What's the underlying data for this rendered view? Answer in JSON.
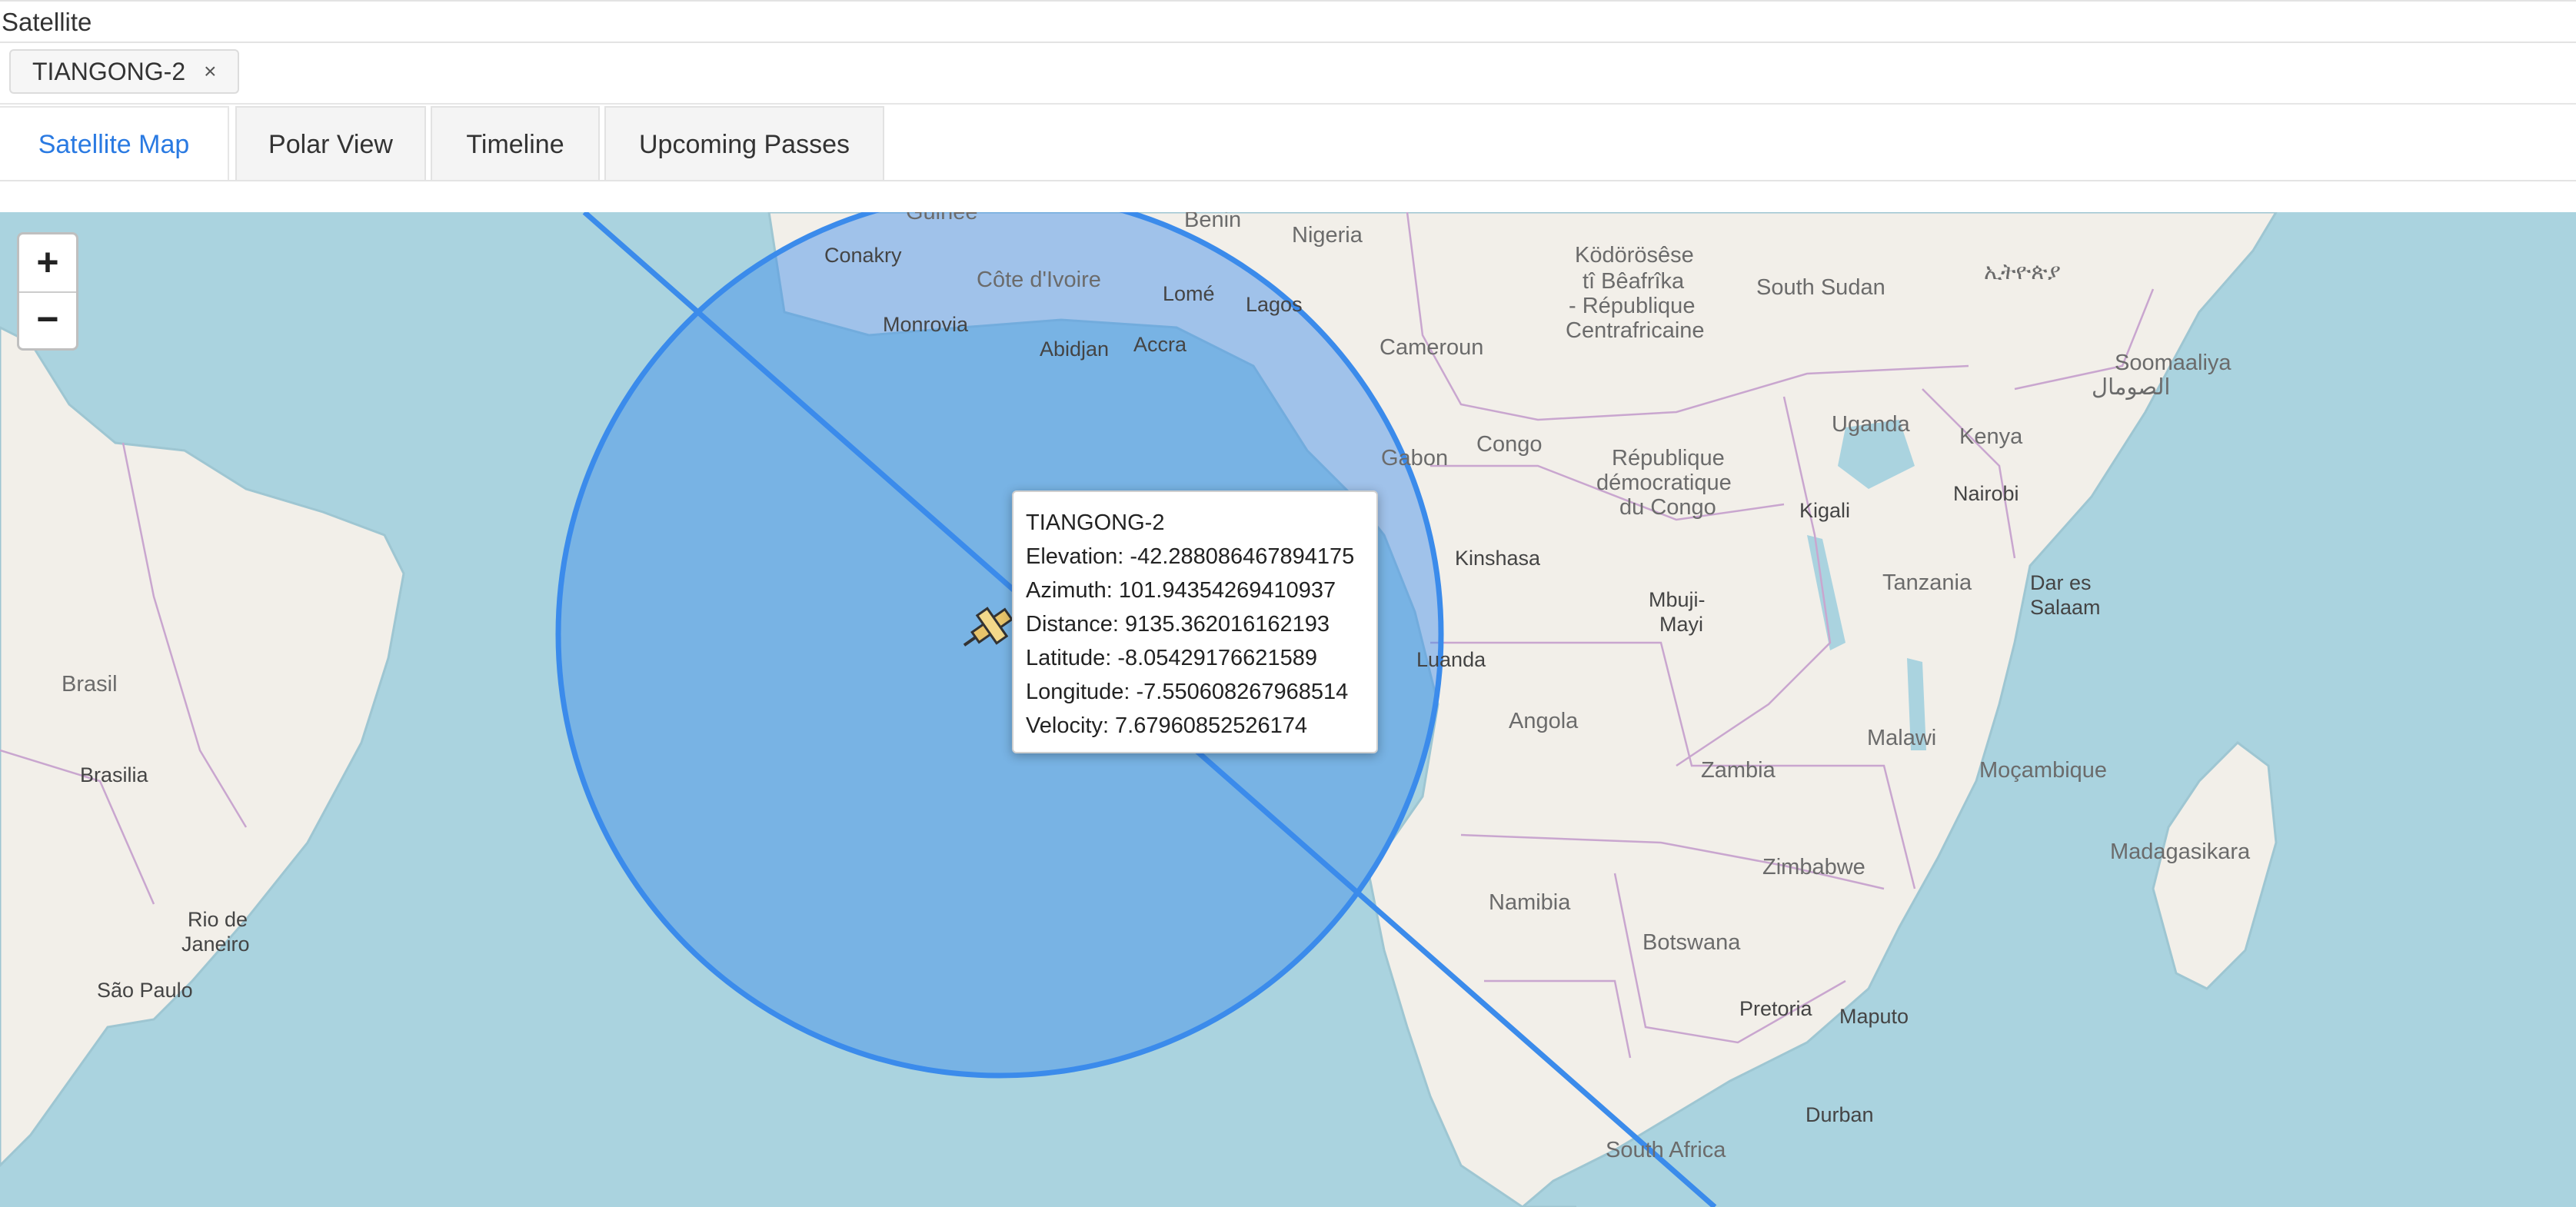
{
  "header": {
    "title": "Satellite"
  },
  "selection": {
    "chip_label": "TIANGONG-2",
    "chip_close": "×"
  },
  "tabs": [
    {
      "label": "Satellite Map",
      "active": true
    },
    {
      "label": "Polar View",
      "active": false
    },
    {
      "label": "Timeline",
      "active": false
    },
    {
      "label": "Upcoming Passes",
      "active": false
    }
  ],
  "map": {
    "zoom_in": "+",
    "zoom_out": "−",
    "colors": {
      "water": "#aad3df",
      "land": "#f2efe9",
      "footprint": "#3b8beb",
      "border": "#c9a6cf"
    },
    "satellite_icon": "satellite-icon",
    "labels": {
      "guinee": "Guinée",
      "benin": "Benin",
      "nigeria": "Nigeria",
      "conakry": "Conakry",
      "cote_divoire": "Côte d'Ivoire",
      "lome": "Lomé",
      "lagos": "Lagos",
      "monrovia": "Monrovia",
      "abidjan": "Abidjan",
      "accra": "Accra",
      "cameroun": "Cameroun",
      "kodorosese": "Ködörösêse",
      "ti_beafrika": "tî Bêafrîka",
      "rep_centrafricaine": "- République",
      "centrafricaine": "Centrafricaine",
      "south_sudan": "South Sudan",
      "ethiopia": "ኢትዮጵያ",
      "soomaaliya": "Soomaaliya",
      "somali_ar": "الصومال",
      "gabon": "Gabon",
      "congo": "Congo",
      "rdc1": "République",
      "rdc2": "démocratique",
      "rdc3": "du Congo",
      "uganda": "Uganda",
      "kenya": "Kenya",
      "kigali": "Kigali",
      "nairobi": "Nairobi",
      "kinshasa": "Kinshasa",
      "mbuji1": "Mbuji-",
      "mbuji2": "Mayi",
      "tanzania": "Tanzania",
      "dar1": "Dar es",
      "dar2": "Salaam",
      "brasil": "Brasil",
      "luanda": "Luanda",
      "angola": "Angola",
      "brasilia": "Brasilia",
      "zambia": "Zambia",
      "malawi": "Malawi",
      "mocambique": "Moçambique",
      "zimbabwe": "Zimbabwe",
      "madagasikara": "Madagasikara",
      "namibia": "Namibia",
      "rio1": "Rio de",
      "rio2": "Janeiro",
      "sao_paulo": "São Paulo",
      "botswana": "Botswana",
      "pretoria": "Pretoria",
      "maputo": "Maputo",
      "durban": "Durban",
      "south_africa": "South Africa"
    }
  },
  "popup": {
    "name": "TIANGONG-2",
    "elevation": "Elevation: -42.288086467894175",
    "azimuth": "Azimuth: 101.94354269410937",
    "distance": "Distance: 9135.362016162193",
    "latitude": "Latitude: -8.05429176621589",
    "longitude": "Longitude: -7.550608267968514",
    "velocity": "Velocity: 7.67960852526174"
  }
}
